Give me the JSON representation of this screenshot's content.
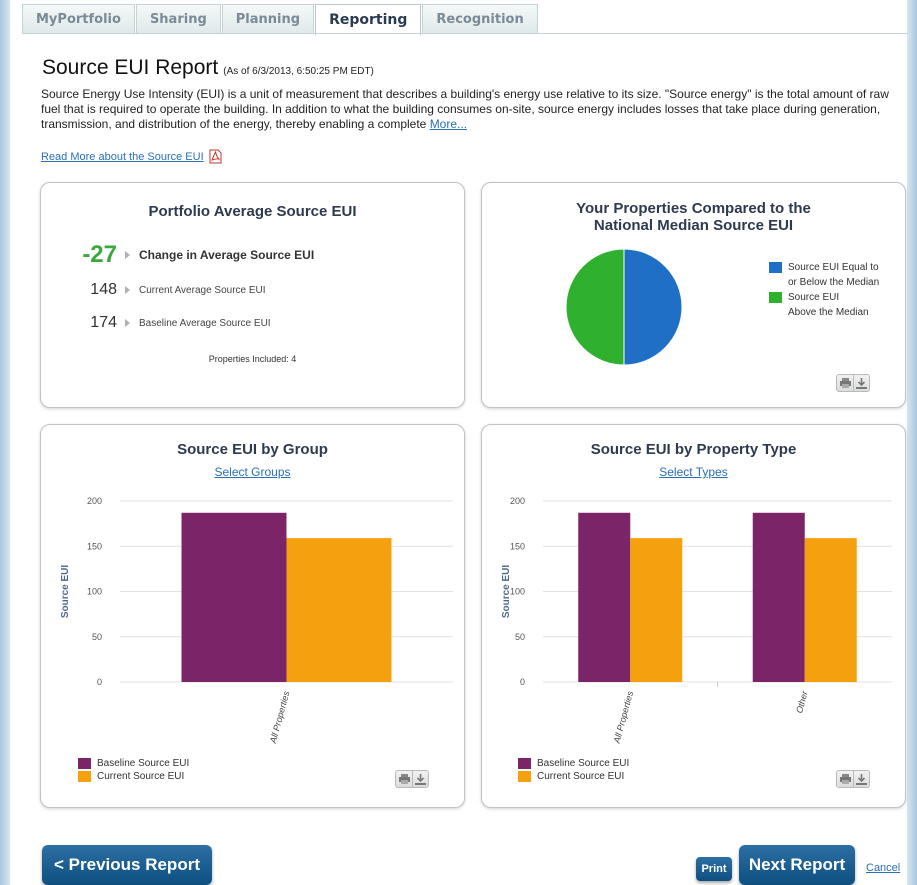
{
  "tabs": [
    {
      "label": "MyPortfolio",
      "active": false
    },
    {
      "label": "Sharing",
      "active": false
    },
    {
      "label": "Planning",
      "active": false
    },
    {
      "label": "Reporting",
      "active": true
    },
    {
      "label": "Recognition",
      "active": false
    }
  ],
  "header": {
    "title": "Source EUI Report",
    "as_of": "(As of 6/3/2013, 6:50:25 PM EDT)",
    "intro": "Source Energy Use Intensity (EUI) is a unit of measurement that describes a building's energy use relative to its size. \"Source energy\" is the total amount of raw fuel that is required to operate the building. In addition to what the building consumes on-site, source energy includes losses that take place during generation, transmission, and distribution of the energy, thereby enabling a complete",
    "more_link": "More...",
    "read_more_link": "Read More about the Source EUI",
    "pdf_icon": "pdf-icon"
  },
  "portfolio_panel": {
    "title": "Portfolio Average Source EUI",
    "change_value": "-27",
    "change_label": "Change in Average Source EUI",
    "current_value": "148",
    "current_label": "Current Average Source EUI",
    "baseline_value": "174",
    "baseline_label": "Baseline Average Source EUI",
    "properties_included": "Properties Included: 4",
    "colors": {
      "change": "#3aa83a"
    }
  },
  "median_panel": {
    "title_line1": "Your Properties Compared to the",
    "title_line2": "National Median Source EUI",
    "legend": [
      {
        "lines": [
          "Source EUI Equal to",
          "or Below the Median"
        ],
        "color": "#1f6fc6"
      },
      {
        "lines": [
          "Source EUI",
          "Above the Median"
        ],
        "color": "#2fb02f"
      }
    ]
  },
  "group_panel": {
    "title": "Source EUI by Group",
    "select_link": "Select Groups"
  },
  "type_panel": {
    "title": "Source EUI by Property Type",
    "select_link": "Select Types"
  },
  "icons": {
    "print": "print-icon",
    "download": "download-icon"
  },
  "chart_data": [
    {
      "type": "pie",
      "labels": [
        "Source EUI Equal to or Below the Median",
        "Source EUI Above the Median"
      ],
      "values": [
        50,
        50
      ],
      "colors": [
        "#1f6fc6",
        "#2fb02f"
      ]
    },
    {
      "type": "bar",
      "title": "Source EUI by Group",
      "ylabel": "Source EUI",
      "categories": [
        "All Properties"
      ],
      "series": [
        {
          "name": "Baseline Source EUI",
          "values": [
            187
          ],
          "color": "#7b2467"
        },
        {
          "name": "Current Source EUI",
          "values": [
            159
          ],
          "color": "#f5a00f"
        }
      ],
      "ylim": [
        0,
        200
      ],
      "yticks": [
        0,
        50,
        100,
        150,
        200
      ],
      "grid": true,
      "legend": "bottom-left"
    },
    {
      "type": "bar",
      "title": "Source EUI by Property Type",
      "ylabel": "Source EUI",
      "categories": [
        "All Properties",
        "Other"
      ],
      "series": [
        {
          "name": "Baseline Source EUI",
          "values": [
            187,
            187
          ],
          "color": "#7b2467"
        },
        {
          "name": "Current Source EUI",
          "values": [
            159,
            159
          ],
          "color": "#f5a00f"
        }
      ],
      "ylim": [
        0,
        200
      ],
      "yticks": [
        0,
        50,
        100,
        150,
        200
      ],
      "grid": true,
      "legend": "bottom-left"
    }
  ],
  "footer": {
    "prev_label": "< Previous Report",
    "print_label": "Print",
    "next_label": "Next Report",
    "cancel_label": "Cancel"
  }
}
